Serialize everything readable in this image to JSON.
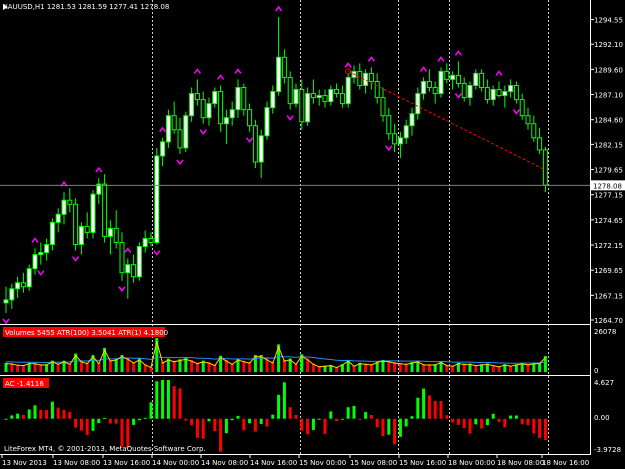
{
  "colors": {
    "background": "#000000",
    "bull_candle": "#00ff00",
    "bear_fill": "#000000",
    "bull_fill": "#ffffff",
    "fractal": "#ff00ff",
    "trendline": "#ff0000",
    "panel_sep": "#ffffff",
    "vol_up": "#00ff00",
    "vol_down": "#ff0000",
    "atr100": "#1e90ff",
    "atr1": "#ffd700",
    "ac_up": "#00ff00",
    "ac_down": "#ff0000",
    "label_badge_bg": "#ff0000",
    "price_badge_bg": "#ffffff"
  },
  "main": {
    "header": "XAUUSD,H1  1281.53 1281.59 1277.41 1278.08",
    "current_price_label": "1278.08",
    "price_axis": [
      "1294.55",
      "1292.10",
      "1289.60",
      "1287.10",
      "1284.60",
      "1282.15",
      "1279.65",
      "1277.15",
      "1274.65",
      "1272.15",
      "1269.65",
      "1267.15",
      "1264.70"
    ]
  },
  "volume_panel": {
    "label": "Volumes 5455  ATR(100) 3.5041  ATR(1) 4.1800",
    "axis_top": "26078",
    "axis_bottom": "0"
  },
  "ac_panel": {
    "label": "AC -1.4116",
    "axis_top": "4.627",
    "axis_mid": "0.00",
    "axis_bottom": "-3.9728"
  },
  "footer": "LiteForex MT4, © 2001-2013, MetaQuotes Software Corp.",
  "time_axis": [
    "13 Nov 2013",
    "13 Nov 08:00",
    "13 Nov 16:00",
    "14 Nov 00:00",
    "14 Nov 08:00",
    "14 Nov 16:00",
    "15 Nov 00:00",
    "15 Nov 08:00",
    "15 Nov 16:00",
    "18 Nov 00:00",
    "18 Nov 08:00",
    "18 Nov 16:00"
  ],
  "chart_data": {
    "type": "candlestick",
    "symbol": "XAUUSD",
    "timeframe": "H1",
    "ylim": [
      1264.7,
      1295.5
    ],
    "candles": [
      [
        1266.4,
        1268.0,
        1265.4,
        1266.7
      ],
      [
        1266.7,
        1268.3,
        1265.8,
        1267.8
      ],
      [
        1267.8,
        1269.0,
        1266.9,
        1268.4
      ],
      [
        1268.4,
        1269.4,
        1267.4,
        1268.0
      ],
      [
        1268.0,
        1270.2,
        1267.6,
        1269.8
      ],
      [
        1269.8,
        1271.8,
        1269.2,
        1271.2
      ],
      [
        1271.2,
        1272.4,
        1270.2,
        1271.4
      ],
      [
        1271.4,
        1272.8,
        1270.6,
        1272.2
      ],
      [
        1272.2,
        1274.8,
        1271.6,
        1274.4
      ],
      [
        1274.4,
        1275.8,
        1273.4,
        1275.2
      ],
      [
        1275.2,
        1277.4,
        1274.2,
        1276.6
      ],
      [
        1276.6,
        1277.8,
        1275.4,
        1276.2
      ],
      [
        1276.2,
        1276.8,
        1271.6,
        1272.2
      ],
      [
        1272.2,
        1274.4,
        1271.2,
        1274.0
      ],
      [
        1274.0,
        1275.4,
        1272.8,
        1273.4
      ],
      [
        1273.4,
        1277.6,
        1272.8,
        1277.2
      ],
      [
        1277.2,
        1278.8,
        1276.2,
        1278.2
      ],
      [
        1278.2,
        1279.2,
        1272.4,
        1273.0
      ],
      [
        1273.0,
        1274.6,
        1271.2,
        1273.8
      ],
      [
        1273.8,
        1275.6,
        1271.8,
        1272.4
      ],
      [
        1272.4,
        1273.4,
        1268.6,
        1269.4
      ],
      [
        1269.4,
        1270.8,
        1266.8,
        1270.2
      ],
      [
        1270.2,
        1271.2,
        1268.4,
        1269.0
      ],
      [
        1269.0,
        1272.4,
        1268.6,
        1272.0
      ],
      [
        1272.0,
        1273.6,
        1271.4,
        1272.8
      ],
      [
        1272.8,
        1273.4,
        1272.0,
        1272.4
      ],
      [
        1272.4,
        1281.8,
        1272.2,
        1281.0
      ],
      [
        1281.0,
        1282.8,
        1280.0,
        1282.4
      ],
      [
        1282.4,
        1285.6,
        1281.8,
        1285.0
      ],
      [
        1285.0,
        1286.4,
        1283.2,
        1283.6
      ],
      [
        1283.6,
        1284.8,
        1281.2,
        1281.8
      ],
      [
        1281.8,
        1285.4,
        1281.4,
        1285.0
      ],
      [
        1285.0,
        1287.8,
        1284.4,
        1287.2
      ],
      [
        1287.2,
        1288.6,
        1286.0,
        1286.6
      ],
      [
        1286.6,
        1287.4,
        1284.2,
        1284.8
      ],
      [
        1284.8,
        1286.8,
        1284.0,
        1286.2
      ],
      [
        1286.2,
        1287.8,
        1285.8,
        1287.4
      ],
      [
        1287.4,
        1288.0,
        1283.4,
        1284.2
      ],
      [
        1284.2,
        1285.6,
        1282.2,
        1284.8
      ],
      [
        1284.8,
        1286.4,
        1284.0,
        1285.6
      ],
      [
        1285.6,
        1288.6,
        1284.8,
        1287.8
      ],
      [
        1287.8,
        1288.2,
        1285.0,
        1285.6
      ],
      [
        1285.6,
        1286.2,
        1283.4,
        1284.0
      ],
      [
        1284.0,
        1284.6,
        1279.8,
        1280.4
      ],
      [
        1280.4,
        1283.6,
        1278.8,
        1283.0
      ],
      [
        1283.0,
        1286.4,
        1282.6,
        1285.8
      ],
      [
        1285.8,
        1288.0,
        1285.2,
        1287.4
      ],
      [
        1287.4,
        1294.8,
        1287.0,
        1290.8
      ],
      [
        1290.8,
        1291.6,
        1288.2,
        1288.8
      ],
      [
        1288.8,
        1289.4,
        1285.6,
        1286.2
      ],
      [
        1286.2,
        1288.2,
        1285.8,
        1287.6
      ],
      [
        1287.6,
        1288.6,
        1283.6,
        1284.4
      ],
      [
        1284.4,
        1287.8,
        1284.0,
        1287.2
      ],
      [
        1287.2,
        1288.6,
        1286.2,
        1286.8
      ],
      [
        1286.8,
        1287.6,
        1286.0,
        1287.0
      ],
      [
        1287.0,
        1287.6,
        1285.8,
        1286.4
      ],
      [
        1286.4,
        1288.0,
        1286.0,
        1287.6
      ],
      [
        1287.6,
        1288.2,
        1286.8,
        1287.2
      ],
      [
        1287.2,
        1288.0,
        1285.8,
        1286.2
      ],
      [
        1286.2,
        1289.2,
        1285.8,
        1288.8
      ],
      [
        1288.8,
        1290.0,
        1288.2,
        1289.4
      ],
      [
        1289.4,
        1290.2,
        1287.6,
        1288.0
      ],
      [
        1288.0,
        1289.6,
        1287.2,
        1289.2
      ],
      [
        1289.2,
        1289.8,
        1287.6,
        1288.4
      ],
      [
        1288.4,
        1289.2,
        1286.2,
        1286.8
      ],
      [
        1286.8,
        1287.8,
        1284.4,
        1285.0
      ],
      [
        1285.0,
        1285.8,
        1282.6,
        1283.2
      ],
      [
        1283.2,
        1284.2,
        1281.4,
        1282.2
      ],
      [
        1282.2,
        1283.4,
        1280.8,
        1282.8
      ],
      [
        1282.8,
        1284.6,
        1282.2,
        1284.0
      ],
      [
        1284.0,
        1285.8,
        1283.0,
        1285.2
      ],
      [
        1285.2,
        1287.8,
        1284.6,
        1287.2
      ],
      [
        1287.2,
        1288.8,
        1286.6,
        1288.4
      ],
      [
        1288.4,
        1289.6,
        1287.4,
        1287.8
      ],
      [
        1287.8,
        1288.4,
        1286.2,
        1287.2
      ],
      [
        1287.2,
        1289.8,
        1286.8,
        1289.4
      ],
      [
        1289.4,
        1290.2,
        1288.2,
        1288.6
      ],
      [
        1288.6,
        1289.4,
        1287.6,
        1289.0
      ],
      [
        1289.0,
        1290.4,
        1287.8,
        1288.2
      ],
      [
        1288.2,
        1288.8,
        1286.4,
        1286.8
      ],
      [
        1286.8,
        1288.4,
        1286.0,
        1288.0
      ],
      [
        1288.0,
        1289.6,
        1287.6,
        1289.2
      ],
      [
        1289.2,
        1289.6,
        1287.4,
        1287.8
      ],
      [
        1287.8,
        1288.6,
        1286.2,
        1286.6
      ],
      [
        1286.6,
        1288.0,
        1286.0,
        1287.6
      ],
      [
        1287.6,
        1288.4,
        1286.8,
        1287.0
      ],
      [
        1287.0,
        1288.0,
        1285.8,
        1287.4
      ],
      [
        1287.4,
        1288.6,
        1286.8,
        1288.0
      ],
      [
        1288.0,
        1288.4,
        1286.2,
        1286.6
      ],
      [
        1286.6,
        1287.2,
        1284.6,
        1285.0
      ],
      [
        1285.0,
        1285.8,
        1283.6,
        1284.2
      ],
      [
        1284.2,
        1285.0,
        1282.4,
        1282.8
      ],
      [
        1282.8,
        1283.8,
        1281.2,
        1281.6
      ],
      [
        1281.6,
        1281.9,
        1277.4,
        1278.1
      ]
    ],
    "fractals_up_bars": [
      5,
      10,
      16,
      21,
      27,
      33,
      37,
      40,
      47,
      59,
      63,
      72,
      75,
      78,
      85
    ],
    "fractals_down_bars": [
      0,
      6,
      12,
      20,
      26,
      30,
      34,
      42,
      49,
      66,
      78,
      88
    ],
    "trendline": {
      "from_bar": 59,
      "from_price": 1289.4,
      "to_bar": 93,
      "to_price": 1279.6
    },
    "current_price": 1278.08,
    "volume_ylim": [
      0,
      26078
    ],
    "atr100_ylim_note": "overlay",
    "ac_ylim": [
      -3.9728,
      4.627
    ]
  }
}
